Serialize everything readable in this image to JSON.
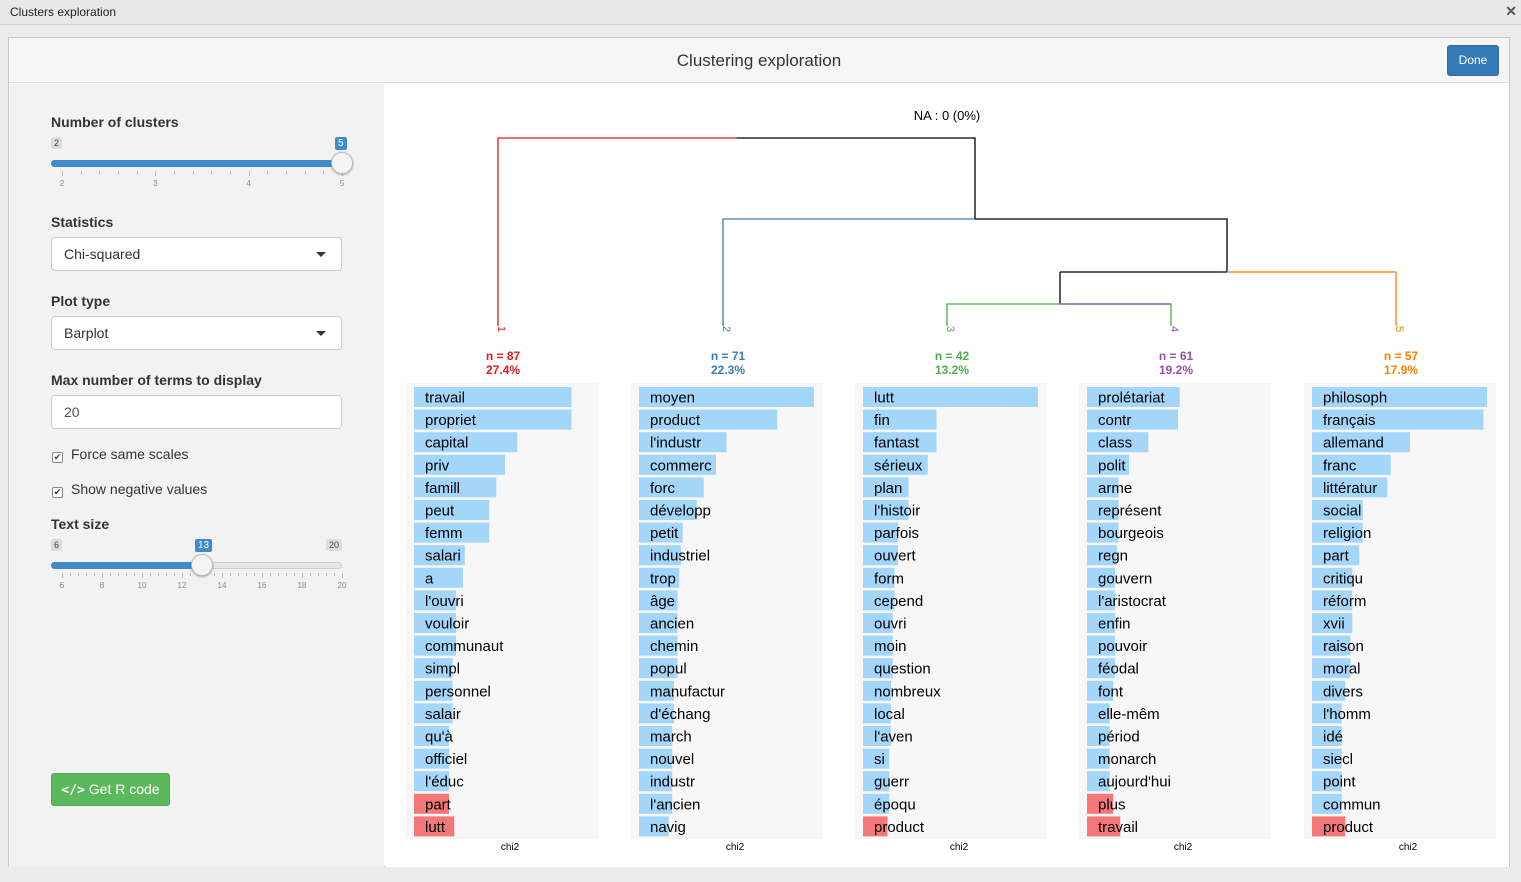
{
  "window": {
    "title": "Clusters exploration",
    "close_glyph": "✕"
  },
  "header": {
    "title": "Clustering exploration",
    "done_label": "Done"
  },
  "sidebar": {
    "n_clusters": {
      "label": "Number of clusters",
      "min": 2,
      "max": 5,
      "value": 5,
      "ticks": [
        "2",
        "3",
        "4",
        "5"
      ]
    },
    "statistics": {
      "label": "Statistics",
      "value": "Chi-squared"
    },
    "plot_type": {
      "label": "Plot type",
      "value": "Barplot"
    },
    "max_terms": {
      "label": "Max number of terms to display",
      "value": "20"
    },
    "force_same_scales": {
      "label": "Force same scales",
      "checked": true
    },
    "show_negative": {
      "label": "Show negative values",
      "checked": true
    },
    "text_size": {
      "label": "Text size",
      "min": 6,
      "max": 20,
      "value": 13,
      "ticks": [
        "6",
        "8",
        "10",
        "12",
        "14",
        "16",
        "18",
        "20"
      ]
    },
    "rcode_label": "Get R code",
    "rcode_icon": "code-icon"
  },
  "plot": {
    "na_label": "NA : 0 (0%)",
    "axis_label": "chi2",
    "colors": {
      "positive": "#a4d6fa",
      "negative": "#f4787a",
      "panel_bg": "#f7f7f7"
    },
    "clusters": [
      {
        "id": "1",
        "color": "#e41a1c",
        "n_label": "n = 87",
        "pct_label": "27.4%",
        "terms": [
          "travail",
          "propriet",
          "capital",
          "priv",
          "famill",
          "peut",
          "femm",
          "salari",
          "a",
          "l'ouvri",
          "vouloir",
          "communaut",
          "simpl",
          "personnel",
          "salair",
          "qu'à",
          "officiel",
          "l'éduc",
          "part",
          "lutt"
        ],
        "values": [
          0.9,
          0.9,
          0.59,
          0.52,
          0.47,
          0.43,
          0.43,
          0.29,
          0.28,
          0.24,
          0.24,
          0.24,
          0.22,
          0.22,
          0.22,
          0.2,
          0.2,
          0.2,
          -0.2,
          -0.23
        ]
      },
      {
        "id": "2",
        "color": "#377eb8",
        "n_label": "n = 71",
        "pct_label": "22.3%",
        "terms": [
          "moyen",
          "product",
          "l'industr",
          "commerc",
          "forc",
          "développ",
          "petit",
          "industriel",
          "trop",
          "âge",
          "ancien",
          "chemin",
          "popul",
          "manufactur",
          "d'échang",
          "march",
          "nouvel",
          "industr",
          "l'ancien",
          "navig"
        ],
        "values": [
          1.0,
          0.79,
          0.5,
          0.44,
          0.37,
          0.33,
          0.25,
          0.24,
          0.23,
          0.22,
          0.22,
          0.22,
          0.22,
          0.2,
          0.2,
          0.19,
          0.19,
          0.19,
          0.19,
          0.17
        ]
      },
      {
        "id": "3",
        "color": "#4daf4a",
        "n_label": "n = 42",
        "pct_label": "13.2%",
        "terms": [
          "lutt",
          "fin",
          "fantast",
          "sérieux",
          "plan",
          "l'histoir",
          "parfois",
          "ouvert",
          "form",
          "cepend",
          "ouvri",
          "moin",
          "question",
          "nombreux",
          "local",
          "l'aven",
          "si",
          "guerr",
          "époqu",
          "product"
        ],
        "values": [
          1.0,
          0.42,
          0.42,
          0.37,
          0.26,
          0.26,
          0.2,
          0.2,
          0.18,
          0.18,
          0.17,
          0.17,
          0.17,
          0.16,
          0.16,
          0.16,
          0.15,
          0.15,
          0.15,
          -0.14
        ]
      },
      {
        "id": "4",
        "color": "#984ea3",
        "n_label": "n = 61",
        "pct_label": "19.2%",
        "terms": [
          "prolétariat",
          "contr",
          "class",
          "polit",
          "arme",
          "représent",
          "bourgeois",
          "regn",
          "gouvern",
          "l'aristocrat",
          "enfin",
          "pouvoir",
          "féodal",
          "font",
          "elle-mêm",
          "périod",
          "monarch",
          "aujourd'hui",
          "plus",
          "travail"
        ],
        "values": [
          0.53,
          0.52,
          0.35,
          0.24,
          0.18,
          0.18,
          0.18,
          0.17,
          0.16,
          0.16,
          0.16,
          0.16,
          0.16,
          0.15,
          0.13,
          0.13,
          0.13,
          0.13,
          -0.15,
          -0.19
        ]
      },
      {
        "id": "5",
        "color": "#ff7f00",
        "n_label": "n = 57",
        "pct_label": "17.9%",
        "terms": [
          "philosoph",
          "français",
          "allemand",
          "franc",
          "littératur",
          "social",
          "religion",
          "part",
          "critiqu",
          "réform",
          "xvii",
          "raison",
          "moral",
          "divers",
          "l'homm",
          "idé",
          "siecl",
          "point",
          "commun",
          "product"
        ],
        "values": [
          1.0,
          0.98,
          0.56,
          0.45,
          0.43,
          0.29,
          0.29,
          0.27,
          0.23,
          0.23,
          0.23,
          0.22,
          0.22,
          0.19,
          0.17,
          0.17,
          0.17,
          0.17,
          0.17,
          -0.19
        ]
      }
    ]
  }
}
